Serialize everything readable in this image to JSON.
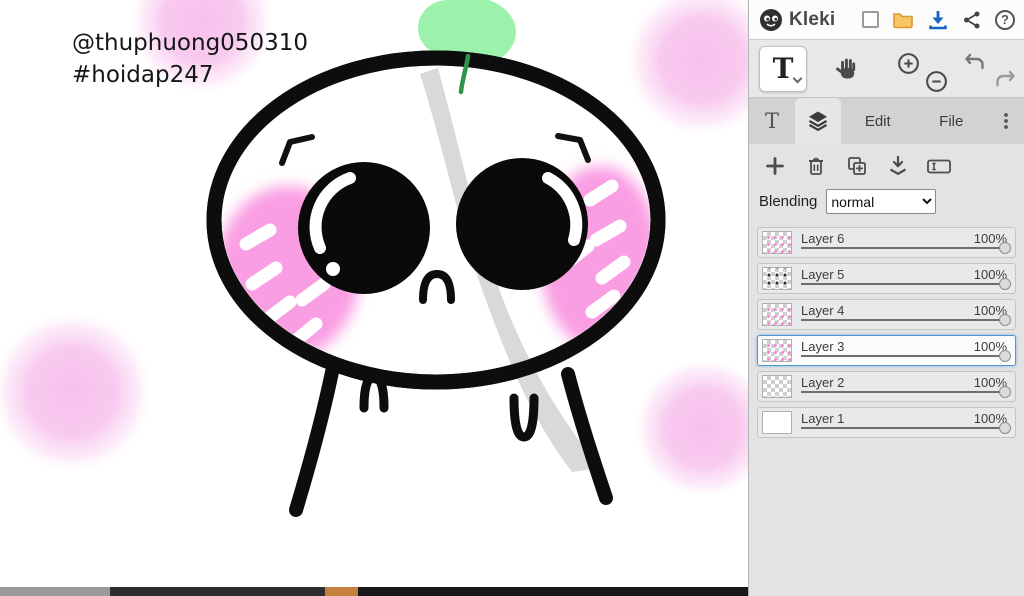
{
  "header": {
    "brand": "Kleki",
    "help_glyph": "?"
  },
  "icons": {
    "text_tool": "T"
  },
  "tabs": {
    "edit": "Edit",
    "file": "File"
  },
  "layers_panel": {
    "blending_label": "Blending",
    "blending_value": "normal",
    "items": [
      {
        "name": "Layer 6",
        "opacity": "100%",
        "thumb": "t-checker-pink",
        "selected": false
      },
      {
        "name": "Layer 5",
        "opacity": "100%",
        "thumb": "t-checker-black",
        "selected": false
      },
      {
        "name": "Layer 4",
        "opacity": "100%",
        "thumb": "t-checker-pink",
        "selected": false
      },
      {
        "name": "Layer 3",
        "opacity": "100%",
        "thumb": "t-checker-pink",
        "selected": true
      },
      {
        "name": "Layer 2",
        "opacity": "100%",
        "thumb": "t-checker",
        "selected": false
      },
      {
        "name": "Layer 1",
        "opacity": "100%",
        "thumb": "t-white",
        "selected": false
      }
    ]
  },
  "canvas": {
    "text_line1": "@thuphuong050310",
    "text_line2": "#hoidap247"
  },
  "colors": {
    "download_blue": "#1665c0",
    "selected_layer_border": "#4f96d6",
    "blob_pink": "#f7bdec",
    "cheek_pink": "#fa9ee3",
    "apple_green": "#9cf2ab",
    "shade_gray": "#d9d9d9"
  }
}
